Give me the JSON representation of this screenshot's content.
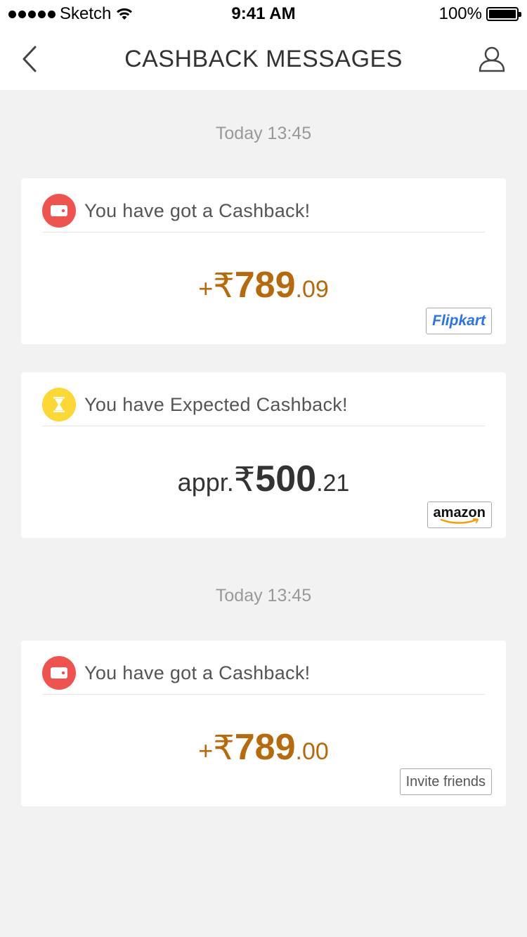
{
  "status_bar": {
    "carrier": "Sketch",
    "time": "9:41 AM",
    "battery": "100%",
    "battery_level": 1.0
  },
  "nav": {
    "title": "CASHBACK MESSAGES",
    "back_icon": "chevron-left-icon",
    "profile_icon": "user-icon"
  },
  "groups": [
    {
      "timestamp": "Today 13:45"
    },
    {
      "timestamp": "Today 13:45"
    }
  ],
  "messages": [
    {
      "icon": "wallet-icon",
      "title": "You have got a Cashback!",
      "amount_prefix": "+",
      "currency": "₹",
      "amount_main": "789",
      "amount_decimal": ".09",
      "merchant": "Flipkart"
    },
    {
      "icon": "hourglass-icon",
      "title": "You have Expected Cashback!",
      "amount_prefix": "appr.",
      "currency": "₹",
      "amount_main": "500",
      "amount_decimal": ".21",
      "merchant": "amazon"
    },
    {
      "icon": "wallet-icon",
      "title": "You have got a Cashback!",
      "amount_prefix": "+",
      "currency": "₹",
      "amount_main": "789",
      "amount_decimal": ".00",
      "action": "Invite friends"
    }
  ],
  "colors": {
    "background": "#f2f2f2",
    "card": "#ffffff",
    "amount_orange": "#b8690a",
    "amount_dark": "#333333",
    "wallet_red": "#ef5350",
    "hourglass_yellow": "#fdd835",
    "flipkart_blue": "#2874f0",
    "amazon_orange": "#ff9900"
  }
}
